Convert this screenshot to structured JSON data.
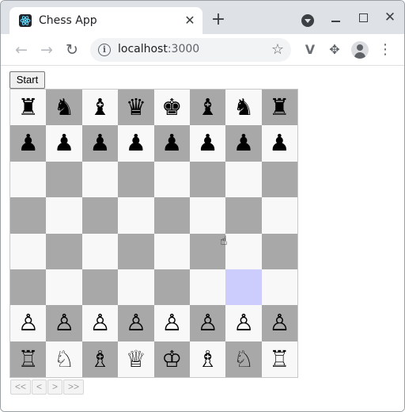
{
  "browser": {
    "tab": {
      "title": "Chess App",
      "favicon": "react-atom-icon",
      "close_glyph": "✕"
    },
    "new_tab_glyph": "+",
    "window_controls": {
      "minimize": "",
      "maximize": "",
      "close_glyph": "✕"
    },
    "nav": {
      "back_glyph": "←",
      "forward_glyph": "→",
      "reload_glyph": "↻"
    },
    "omnibox": {
      "host": "localhost",
      "port": ":3000",
      "info_glyph": "i",
      "bookmark_glyph": "☆"
    },
    "extensions": {
      "vue_glyph": "V",
      "puzzle_glyph": "✥"
    },
    "menu_glyph": "⋮"
  },
  "page": {
    "start_label": "Start",
    "board": {
      "rows": [
        [
          "♜",
          "♞",
          "♝",
          "♛",
          "♚",
          "♝",
          "♞",
          "♜"
        ],
        [
          "♟",
          "♟",
          "♟",
          "♟",
          "♟",
          "♟",
          "♟",
          "♟"
        ],
        [
          "",
          "",
          "",
          "",
          "",
          "",
          "",
          ""
        ],
        [
          "",
          "",
          "",
          "",
          "",
          "",
          "",
          ""
        ],
        [
          "",
          "",
          "",
          "",
          "",
          "",
          "",
          ""
        ],
        [
          "",
          "",
          "",
          "",
          "",
          "",
          "",
          ""
        ],
        [
          "♙",
          "♙",
          "♙",
          "♙",
          "♙",
          "♙",
          "♙",
          "♙"
        ],
        [
          "♖",
          "♘",
          "♗",
          "♕",
          "♔",
          "♗",
          "♘",
          "♖"
        ]
      ],
      "highlighted_square": {
        "row": 5,
        "col": 6
      },
      "colors": {
        "light": "#f8f8f8",
        "dark": "#a8a8a8",
        "highlight": "#cccdfd"
      }
    },
    "history_nav": [
      {
        "label": "<<",
        "name": "first-move-button"
      },
      {
        "label": "<",
        "name": "prev-move-button"
      },
      {
        "label": ">",
        "name": "next-move-button"
      },
      {
        "label": ">>",
        "name": "last-move-button"
      }
    ],
    "cursor_glyph": "☝"
  }
}
